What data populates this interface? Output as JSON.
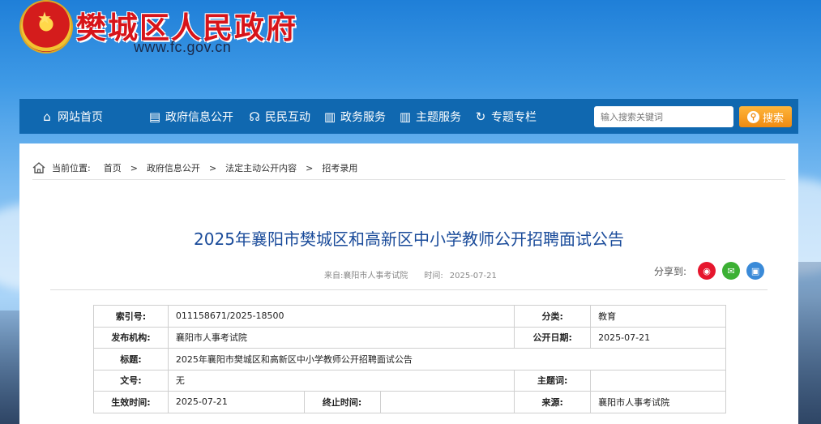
{
  "header": {
    "site_title": "樊城区人民政府",
    "site_url": "www.fc.gov.cn"
  },
  "nav": {
    "items": [
      {
        "label": "网站首页",
        "icon": "home-icon"
      },
      {
        "label": "政府信息公开",
        "icon": "document-icon"
      },
      {
        "label": "民民互动",
        "icon": "chat-icon"
      },
      {
        "label": "政务服务",
        "icon": "building-icon"
      },
      {
        "label": "主题服务",
        "icon": "building-icon"
      },
      {
        "label": "专题专栏",
        "icon": "refresh-icon"
      }
    ],
    "search_placeholder": "输入搜索关键词",
    "search_button": "搜索"
  },
  "breadcrumb": {
    "prefix": "当前位置:",
    "items": [
      "首页",
      "政府信息公开",
      "法定主动公开内容",
      "招考录用"
    ],
    "separator": ">"
  },
  "article": {
    "title": "2025年襄阳市樊城区和高新区中小学教师公开招聘面试公告",
    "source_label": "来自:",
    "source": "襄阳市人事考试院",
    "time_label": "时间:",
    "time": "2025-07-21",
    "share_label": "分享到:"
  },
  "info_table": {
    "index_label": "索引号:",
    "index_value": "011158671/2025-18500",
    "category_label": "分类:",
    "category_value": "教育",
    "publisher_label": "发布机构:",
    "publisher_value": "襄阳市人事考试院",
    "pubdate_label": "公开日期:",
    "pubdate_value": "2025-07-21",
    "title_label": "标题:",
    "title_value": "2025年襄阳市樊城区和高新区中小学教师公开招聘面试公告",
    "docno_label": "文号:",
    "docno_value": "无",
    "subject_label": "主题词:",
    "subject_value": "",
    "effective_label": "生效时间:",
    "effective_value": "2025-07-21",
    "end_label": "终止时间:",
    "end_value": "",
    "origin_label": "来源:",
    "origin_value": "襄阳市人事考试院"
  },
  "colors": {
    "nav_bg": "#1068b0",
    "title_red": "#d7141a",
    "headline_blue": "#1a4b9a",
    "search_orange": "#f08a10"
  }
}
